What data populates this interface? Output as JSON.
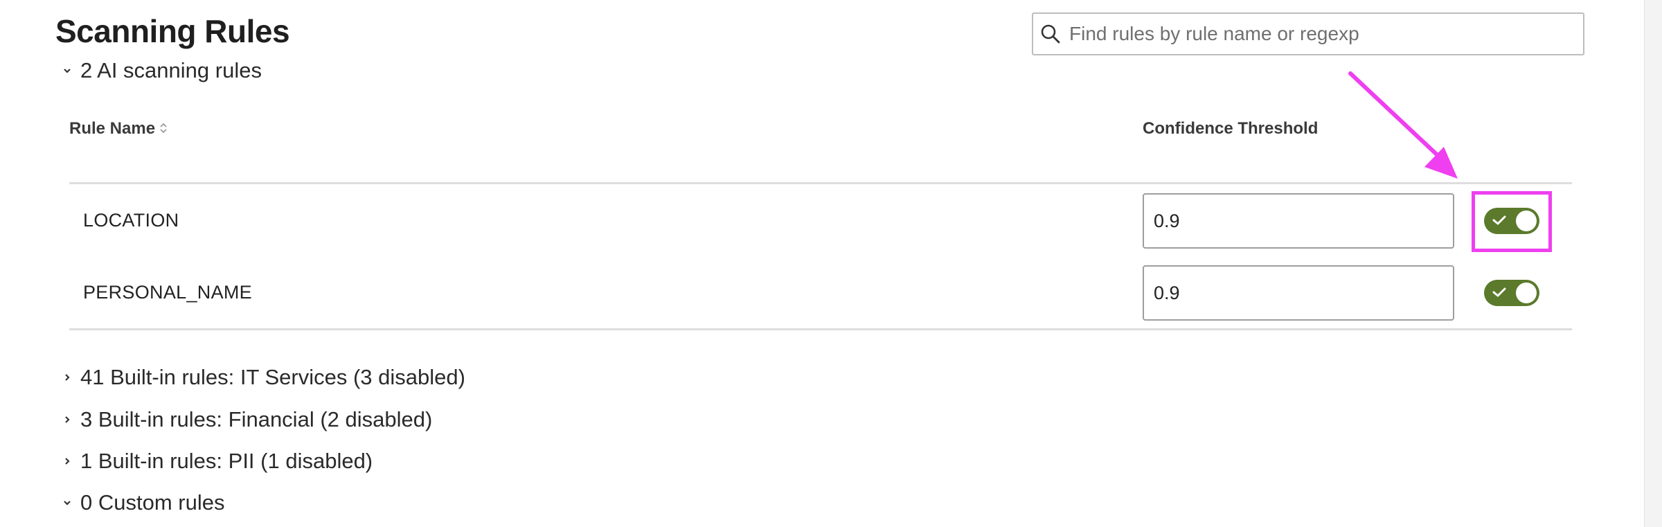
{
  "page": {
    "title": "Scanning Rules"
  },
  "search": {
    "placeholder": "Find rules by rule name or regexp",
    "value": ""
  },
  "ai_group": {
    "label": "2 AI scanning rules",
    "expanded": true
  },
  "table": {
    "columns": {
      "rule_name": "Rule Name",
      "confidence": "Confidence Threshold"
    },
    "rows": [
      {
        "name": "LOCATION",
        "threshold": "0.9",
        "enabled": true
      },
      {
        "name": "PERSONAL_NAME",
        "threshold": "0.9",
        "enabled": true
      }
    ]
  },
  "groups": [
    {
      "label": "41 Built-in rules: IT Services (3 disabled)",
      "expanded": false
    },
    {
      "label": "3 Built-in rules: Financial (2 disabled)",
      "expanded": false
    },
    {
      "label": "1 Built-in rules: PII (1 disabled)",
      "expanded": false
    },
    {
      "label": "0 Custom rules",
      "expanded": true
    }
  ],
  "colors": {
    "toggle_on": "#5b7a2c",
    "annotation": "#ef3ff0"
  },
  "icons": {
    "search": "search-icon",
    "expanded": "chevron-down-icon",
    "collapsed": "chevron-right-icon",
    "sort": "sort-icon",
    "check": "check-icon"
  }
}
